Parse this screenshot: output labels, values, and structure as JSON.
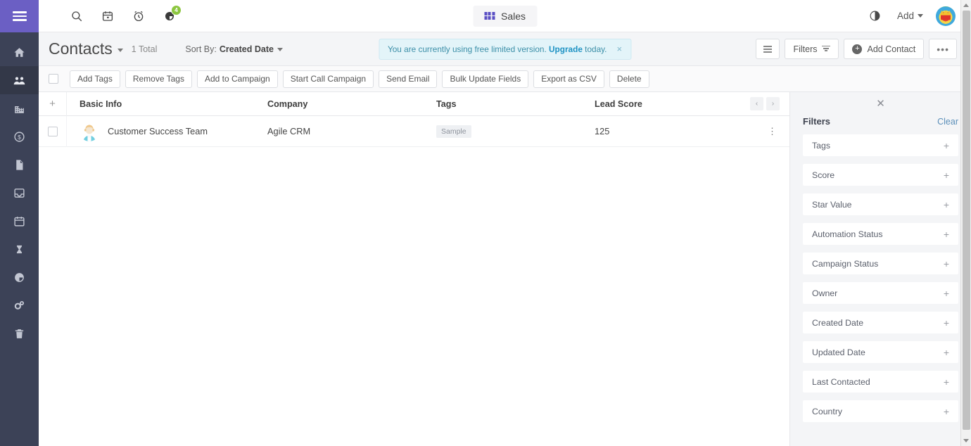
{
  "topbar": {
    "icons": [
      {
        "name": "search-icon",
        "label": "Search"
      },
      {
        "name": "calendar-icon",
        "label": "Calendar"
      },
      {
        "name": "alarm-clock-icon",
        "label": "Reminders"
      },
      {
        "name": "reports-pie-icon",
        "label": "Reports",
        "badge": "4"
      }
    ],
    "app_switcher": {
      "label": "Sales",
      "icon": "grid-icon"
    },
    "half_circle_icon": "contrast-icon",
    "add_menu": {
      "label": "Add"
    },
    "avatar": "user-avatar"
  },
  "sidebar": {
    "menu_icon": "hamburger-icon",
    "items": [
      {
        "name": "sidebar-item-home",
        "label": "Home",
        "icon": "home-icon",
        "active": false
      },
      {
        "name": "sidebar-item-contacts",
        "label": "Contacts",
        "icon": "users-icon",
        "active": true
      },
      {
        "name": "sidebar-item-companies",
        "label": "Companies",
        "icon": "building-icon",
        "active": false
      },
      {
        "name": "sidebar-item-deals",
        "label": "Deals",
        "icon": "dollar-circle-icon",
        "active": false
      },
      {
        "name": "sidebar-item-documents",
        "label": "Documents",
        "icon": "document-icon",
        "active": false
      },
      {
        "name": "sidebar-item-inbox",
        "label": "Inbox",
        "icon": "inbox-icon",
        "active": false
      },
      {
        "name": "sidebar-item-calendar",
        "label": "Calendar",
        "icon": "calendar-icon",
        "active": false
      },
      {
        "name": "sidebar-item-tasks",
        "label": "Tasks",
        "icon": "hourglass-icon",
        "active": false
      },
      {
        "name": "sidebar-item-reports",
        "label": "Reports",
        "icon": "pie-chart-icon",
        "active": false
      },
      {
        "name": "sidebar-item-settings",
        "label": "Settings",
        "icon": "gears-icon",
        "active": false
      },
      {
        "name": "sidebar-item-trash",
        "label": "Trash",
        "icon": "trash-icon",
        "active": false
      }
    ]
  },
  "page_header": {
    "title": "Contacts",
    "total": "1 Total",
    "sort_prefix": "Sort By:",
    "sort_value": "Created Date",
    "banner": {
      "text_before": "You are currently using free limited version.",
      "link": "Upgrade",
      "text_after": "today.",
      "close": "×"
    },
    "buttons": {
      "list_view": "list-view",
      "filters": "Filters",
      "add_contact": "Add Contact",
      "more": "•••"
    }
  },
  "action_bar": {
    "buttons": [
      "Add Tags",
      "Remove Tags",
      "Add to Campaign",
      "Start Call Campaign",
      "Send Email",
      "Bulk Update Fields",
      "Export as CSV",
      "Delete"
    ]
  },
  "table": {
    "plus_column": "+",
    "columns": [
      "Basic Info",
      "Company",
      "Tags",
      "Lead Score"
    ],
    "pager": {
      "prev": "‹",
      "next": "›"
    },
    "rows": [
      {
        "basic_info": "Customer Success Team",
        "company": "Agile CRM",
        "tags": "Sample",
        "lead_score": "125",
        "row_menu": "⋮"
      }
    ]
  },
  "filters_panel": {
    "close": "✕",
    "title": "Filters",
    "clear": "Clear",
    "items": [
      "Tags",
      "Score",
      "Star Value",
      "Automation Status",
      "Campaign Status",
      "Owner",
      "Created Date",
      "Updated Date",
      "Last Contacted",
      "Country"
    ],
    "expand": "+"
  },
  "colors": {
    "sidebar_bg": "#3c4257",
    "sidebar_top": "#6b5fc4",
    "accent_purple": "#5a4fc4",
    "banner_bg": "#e3f4f9",
    "banner_text": "#3c8fa8",
    "link_blue": "#1f93c4",
    "badge_green": "#8cc63f",
    "page_bg": "#f4f5f7"
  }
}
